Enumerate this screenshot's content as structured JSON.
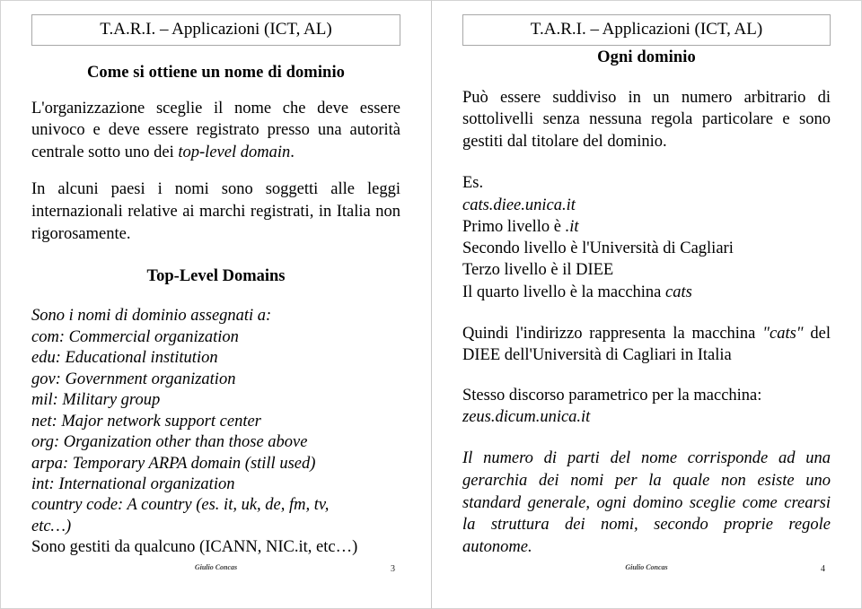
{
  "document": {
    "kind": "presentation-handout",
    "language": "it",
    "colors": {
      "page_background": "#ffffff",
      "text": "#000000",
      "slide_border": "#d3d3d3",
      "title_box_border": "#a8a8a8",
      "footer_text": "#3a3a3a"
    }
  },
  "slides": [
    {
      "header": "T.A.R.I. – Applicazioni (ICT, AL)",
      "subtitle": "Come si ottiene un nome di dominio",
      "paragraph1_a": "L'organizzazione sceglie il nome che deve essere univoco e deve essere registrato presso una autorità centrale sotto uno dei ",
      "paragraph1_em": "top-level domain",
      "paragraph1_b": ".",
      "paragraph2": "In alcuni paesi i nomi sono soggetti alle leggi internazionali relative ai marchi registrati, in Italia non rigorosamente.",
      "section_heading": "Top-Level Domains",
      "tld_intro": "Sono i nomi di dominio assegnati a:",
      "tld_list": [
        "com: Commercial organization",
        "edu: Educational institution",
        "gov: Government organization",
        "mil: Military group",
        "net: Major network support center",
        "org: Organization other than those above",
        "arpa: Temporary ARPA domain (still used)",
        "int: International organization",
        "country code: A country (es. it, uk, de, fm, tv,",
        "etc…)"
      ],
      "tld_closing": "Sono gestiti da qualcuno (ICANN, NIC.it, etc…)",
      "footer_author": "Giulio Concas",
      "footer_page": "3"
    },
    {
      "header": "T.A.R.I. – Applicazioni (ICT, AL)",
      "subtitle": "Ogni dominio",
      "paragraph1": "Può essere suddiviso in un numero arbitrario di sottolivelli senza nessuna regola particolare e sono gestiti dal titolare del dominio.",
      "example_label": "Es.",
      "example_domain": "cats.diee.unica.it",
      "levels": [
        {
          "pre": "Primo livello è ",
          "em": ".it",
          "post": ""
        },
        {
          "pre": "Secondo livello è l'Università di Cagliari",
          "em": "",
          "post": ""
        },
        {
          "pre": "Terzo livello è il DIEE",
          "em": "",
          "post": ""
        },
        {
          "pre": "Il quarto livello è la macchina ",
          "em": "cats",
          "post": ""
        }
      ],
      "paragraph2_a": "Quindi l'indirizzo rappresenta la macchina ",
      "paragraph2_em": "\"cats\"",
      "paragraph2_b": " del DIEE dell'Università di Cagliari in Italia",
      "paragraph3": "Stesso discorso parametrico per la macchina:",
      "paragraph3_domain": "zeus.dicum.unica.it",
      "paragraph4": "Il numero di parti del nome corrisponde ad una gerarchia dei nomi per la quale non esiste uno standard generale, ogni domino sceglie come crearsi la struttura dei nomi, secondo proprie regole autonome.",
      "footer_author": "Giulio Concas",
      "footer_page": "4"
    }
  ]
}
